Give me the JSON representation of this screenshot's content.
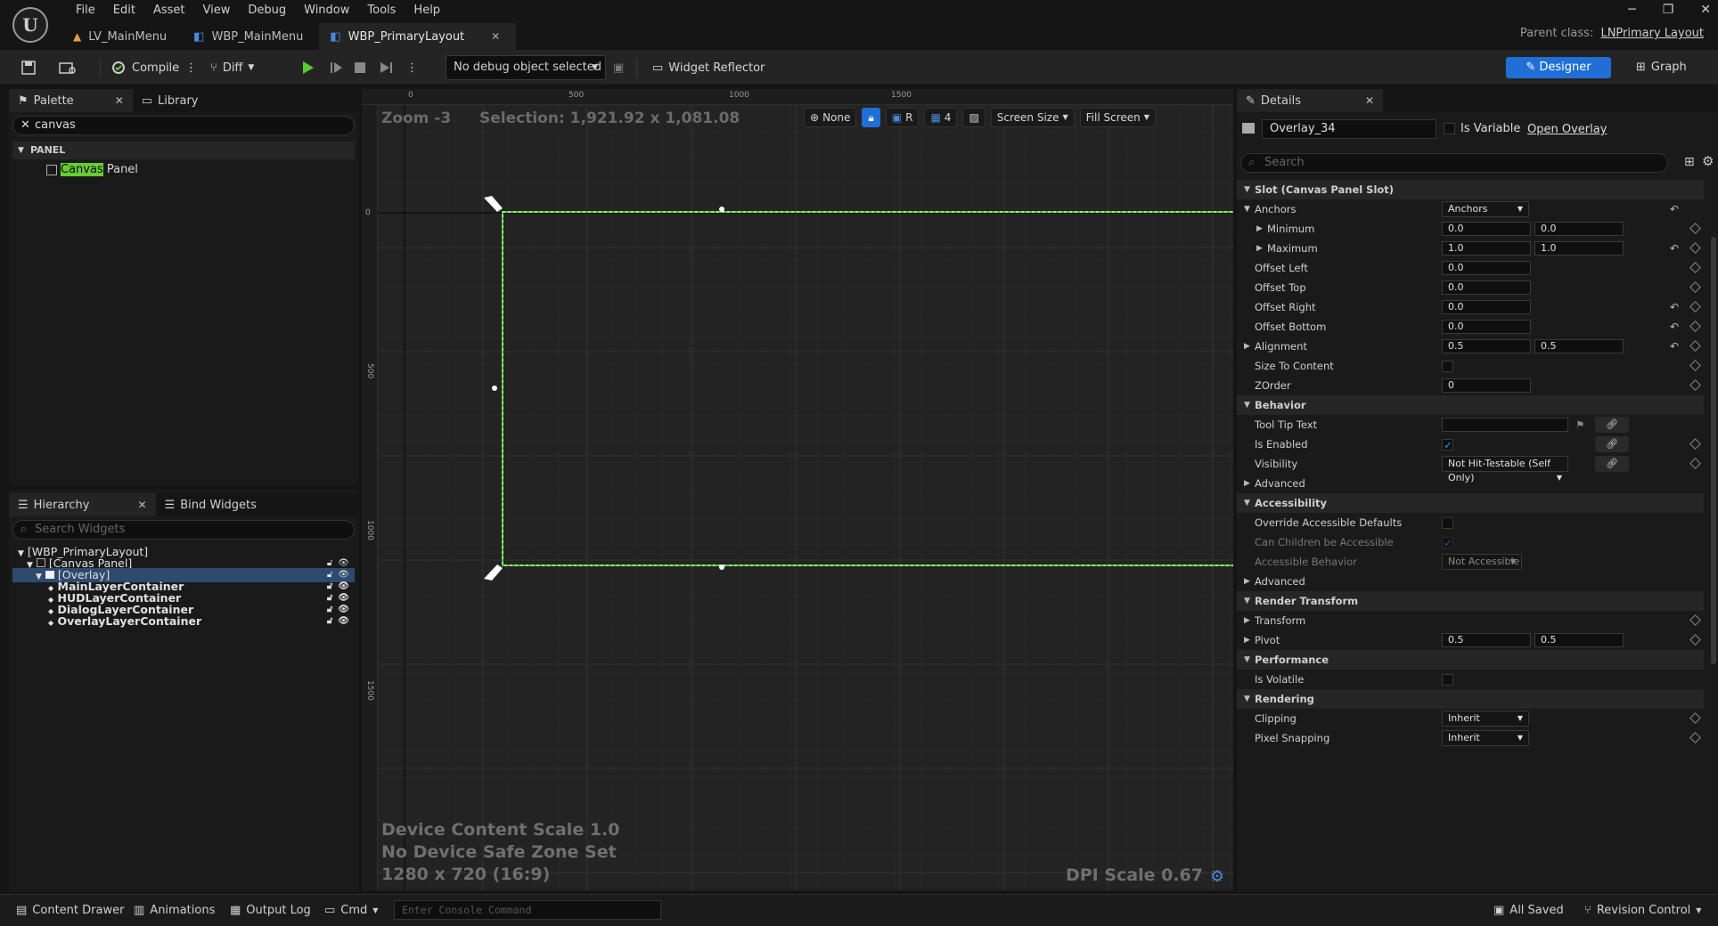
{
  "menu": [
    "File",
    "Edit",
    "Asset",
    "View",
    "Debug",
    "Window",
    "Tools",
    "Help"
  ],
  "tabs": [
    {
      "label": "LV_MainMenu",
      "active": false
    },
    {
      "label": "WBP_MainMenu",
      "active": false
    },
    {
      "label": "WBP_PrimaryLayout",
      "active": true
    }
  ],
  "parent_class": {
    "label": "Parent class:",
    "value": "LNPrimary Layout"
  },
  "toolbar": {
    "compile": "Compile",
    "diff": "Diff",
    "debug_object": "No debug object selected",
    "widget_reflector": "Widget Reflector",
    "designer": "Designer",
    "graph": "Graph"
  },
  "palette": {
    "tab_palette": "Palette",
    "tab_library": "Library",
    "search_value": "canvas",
    "category": "PANEL",
    "item_highlight": "Canvas",
    "item_rest": " Panel"
  },
  "hierarchy": {
    "tab_hierarchy": "Hierarchy",
    "tab_bind": "Bind Widgets",
    "search_placeholder": "Search Widgets",
    "rows": [
      {
        "label": "[WBP_PrimaryLayout]"
      },
      {
        "label": "[Canvas Panel]"
      },
      {
        "label": "[Overlay]"
      },
      {
        "label": "MainLayerContainer"
      },
      {
        "label": "HUDLayerContainer"
      },
      {
        "label": "DialogLayerContainer"
      },
      {
        "label": "OverlayLayerContainer"
      }
    ]
  },
  "viewport": {
    "zoom": "Zoom -3",
    "selection": "Selection: 1,921.92 x 1,081.08",
    "none": "None",
    "r": "R",
    "grid_snap": "4",
    "screen_size": "Screen Size",
    "fill_screen": "Fill Screen",
    "ruler_top": [
      "0",
      "500",
      "1000",
      "1500"
    ],
    "ruler_left": [
      "0",
      "500",
      "1000",
      "1500"
    ],
    "device_scale": "Device Content Scale 1.0",
    "safe_zone": "No Device Safe Zone Set",
    "resolution": "1280 x 720 (16:9)",
    "dpi": "DPI Scale 0.67"
  },
  "details": {
    "tab": "Details",
    "name_value": "Overlay_34",
    "is_variable": "Is Variable",
    "open": "Open Overlay",
    "search_placeholder": "Search",
    "slot_cat": "Slot (Canvas Panel Slot)",
    "anchors": "Anchors",
    "anchors_dd": "Anchors",
    "minimum": "Minimum",
    "min_x": "0.0",
    "min_y": "0.0",
    "maximum": "Maximum",
    "max_x": "1.0",
    "max_y": "1.0",
    "offset_left": "Offset Left",
    "offset_left_v": "0.0",
    "offset_top": "Offset Top",
    "offset_top_v": "0.0",
    "offset_right": "Offset Right",
    "offset_right_v": "0.0",
    "offset_bottom": "Offset Bottom",
    "offset_bottom_v": "0.0",
    "alignment": "Alignment",
    "align_x": "0.5",
    "align_y": "0.5",
    "size_to_content": "Size To Content",
    "zorder": "ZOrder",
    "zorder_v": "0",
    "behavior_cat": "Behavior",
    "tooltip": "Tool Tip Text",
    "is_enabled": "Is Enabled",
    "visibility": "Visibility",
    "visibility_v": "Not Hit-Testable (Self Only)",
    "advanced": "Advanced",
    "accessibility_cat": "Accessibility",
    "override_acc": "Override Accessible Defaults",
    "children_acc": "Can Children be Accessible",
    "acc_behavior": "Accessible Behavior",
    "acc_behavior_v": "Not Accessible",
    "advanced2": "Advanced",
    "render_cat": "Render Transform",
    "transform": "Transform",
    "pivot": "Pivot",
    "pivot_x": "0.5",
    "pivot_y": "0.5",
    "perf_cat": "Performance",
    "is_volatile": "Is Volatile",
    "rendering_cat": "Rendering",
    "clipping": "Clipping",
    "clipping_v": "Inherit",
    "pixel_snapping": "Pixel Snapping",
    "pixel_snapping_v": "Inherit"
  },
  "statusbar": {
    "content_drawer": "Content Drawer",
    "animations": "Animations",
    "output_log": "Output Log",
    "cmd": "Cmd",
    "console_placeholder": "Enter Console Command",
    "all_saved": "All Saved",
    "revision": "Revision Control"
  },
  "colors": {
    "accent": "#1f6fd6",
    "selection": "#44cc22",
    "highlight": "#66cc33"
  }
}
